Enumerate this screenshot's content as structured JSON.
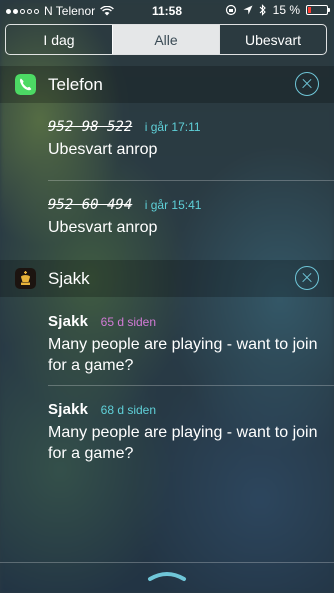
{
  "status_bar": {
    "carrier": "N Telenor",
    "time": "11:58",
    "battery_percent": "15 %",
    "battery_level": 0.15,
    "signal_bars": 2
  },
  "segments": [
    "I dag",
    "Alle",
    "Ubesvart"
  ],
  "selected_segment": "Alle",
  "sections": [
    {
      "app": "Telefon",
      "icon": "phone-icon",
      "items": [
        {
          "sender": "952 98 522",
          "time": "i går 17:11",
          "message": "Ubesvart anrop"
        },
        {
          "sender": "952 60 494",
          "time": "i går 15:41",
          "message": "Ubesvart anrop"
        }
      ]
    },
    {
      "app": "Sjakk",
      "icon": "chess-king-icon",
      "items": [
        {
          "sender": "Sjakk",
          "time": "65 d siden",
          "message": "Many people are playing - want to join for a game?"
        },
        {
          "sender": "Sjakk",
          "time": "68 d siden",
          "message": "Many people are playing - want to join for a game?"
        }
      ]
    }
  ],
  "colors": {
    "accent": "#6fc6d8",
    "time_purple": "#d27bd6",
    "time_teal": "#5fd0d8",
    "phone_green": "#4cd964",
    "battery_low": "#ff3b30"
  }
}
